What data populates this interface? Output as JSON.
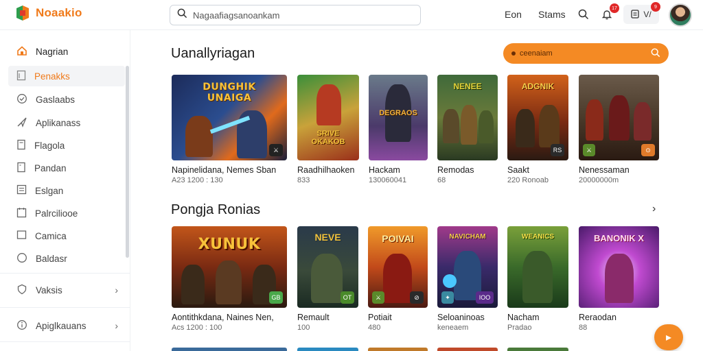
{
  "header": {
    "logo_text": "Noaakio",
    "search_placeholder": "Nagaafiagsanoankam",
    "links": [
      "Eon",
      "Stams"
    ],
    "notif_badge_1": "17",
    "notif_badge_2": "9",
    "pill_label": "V/",
    "icons": [
      "search-icon",
      "bell-icon",
      "clipboard-icon"
    ]
  },
  "sidebar": {
    "items": [
      {
        "label": "Nagrian",
        "icon": "home-icon"
      },
      {
        "label": "Penakks",
        "icon": "document-icon"
      },
      {
        "label": "Gaslaabs",
        "icon": "check-circle-icon"
      },
      {
        "label": "Aplikanass",
        "icon": "send-icon"
      },
      {
        "label": "Flagola",
        "icon": "file-icon"
      },
      {
        "label": "Pandan",
        "icon": "page-icon"
      },
      {
        "label": "Eslgan",
        "icon": "list-icon"
      },
      {
        "label": "Palrciliooe",
        "icon": "calendar-icon"
      },
      {
        "label": "Camica",
        "icon": "folder-icon"
      },
      {
        "label": "Baldasr",
        "icon": "circle-icon"
      },
      {
        "label": "Vaksis",
        "icon": "shield-icon"
      },
      {
        "label": "Apiglkauans",
        "icon": "info-icon"
      }
    ]
  },
  "section1": {
    "title": "Uanallyriagan",
    "search_text": "ceenaiam",
    "cards": [
      {
        "title_art": "DUNGHIK\nUNAIGA",
        "name": "Napinelidana, Nemes Sban",
        "meta": "A23 1200 : 130",
        "corner": "⚔"
      },
      {
        "title_art": "SRIVE\nOKAKOB",
        "name": "Raadhilhaoken",
        "meta": "833",
        "corner": ""
      },
      {
        "title_art": "DEGRAOS",
        "name": "Hackam",
        "meta": "130060041",
        "corner": ""
      },
      {
        "title_art": "NENEE",
        "name": "Remodas",
        "meta": "68",
        "corner": ""
      },
      {
        "title_art": "ADGNIK",
        "name": "Saakt",
        "meta": "220 Ronoab",
        "corner": "RS"
      },
      {
        "title_art": "",
        "name": "Nenessaman",
        "meta": "20000000m",
        "corner": "⊙"
      }
    ]
  },
  "section2": {
    "title": "Pongja Ronias",
    "cards": [
      {
        "title_art": "XUNUK",
        "name": "Aontithkdana, Naines Nen,",
        "meta": "Acs 1200 : 100",
        "corner": "GB"
      },
      {
        "title_art": "NEVE",
        "name": "Remault",
        "meta": "100",
        "corner": "OT"
      },
      {
        "title_art": "POIVAI",
        "name": "Potiait",
        "meta": "480",
        "corner": "⊘"
      },
      {
        "title_art": "NAVICHAM",
        "name": "Seloaninoas",
        "meta": "keneaem",
        "corner": "IOO"
      },
      {
        "title_art": "WEANICS",
        "name": "Nacham",
        "meta": "Pradao",
        "corner": ""
      },
      {
        "title_art": "BANONIK X",
        "name": "Reraodan",
        "meta": "88",
        "corner": ""
      }
    ]
  },
  "colors": {
    "accent": "#f07a1a",
    "search_pill": "#f48a24",
    "badge": "#e02828"
  }
}
